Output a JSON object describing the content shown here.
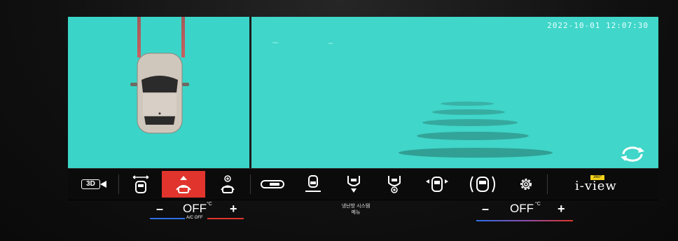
{
  "camera": {
    "timestamp": "2022-10-01  12:07:30"
  },
  "toolbar": {
    "view_3d_label": "3D",
    "iview_badge": "360°",
    "iview_label": "i-view"
  },
  "climate": {
    "left": {
      "minus": "–",
      "value": "OFF",
      "unit": "°C",
      "plus": "+",
      "ac_label": "A/C OFF"
    },
    "right": {
      "minus": "–",
      "value": "OFF",
      "unit": "°C",
      "plus": "+"
    }
  },
  "center_menu": {
    "line1": "냉난방 시스템",
    "line2": "메뉴"
  },
  "colors": {
    "camera_bg": "#3ad5c8",
    "active_button": "#e0342c",
    "cool_bar": "#2c6ee8",
    "warm_bar": "#e0342c"
  },
  "icons": [
    "view-3d-icon",
    "front-wide-icon",
    "front-top-icon",
    "front-near-icon",
    "side-view-icon",
    "rear-top-icon",
    "rear-wide-icon",
    "rear-near-icon",
    "side-wide-icon",
    "around-view-icon",
    "settings-icon",
    "iview-logo"
  ]
}
